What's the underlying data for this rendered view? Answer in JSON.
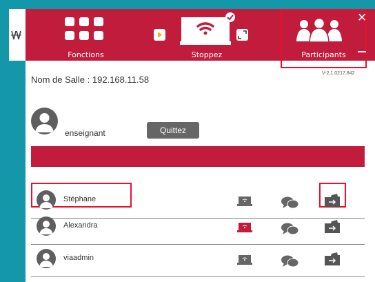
{
  "app": {
    "tabs": {
      "fonctions": "Fonctions",
      "stoppez": "Stoppez",
      "participants": "Participants"
    },
    "close_symbol": "✕"
  },
  "room": {
    "label": "Nom de Salle : 192.168.11.58",
    "version": "V-2.1.0217.842"
  },
  "teacher": {
    "name": "enseignant",
    "quit_label": "Quittez"
  },
  "participants": [
    {
      "name": "Stéphane",
      "screen_active": false
    },
    {
      "name": "Alexandra",
      "screen_active": true
    },
    {
      "name": "viaadmin",
      "screen_active": false
    }
  ],
  "colors": {
    "brand_red": "#c21c3d",
    "background_teal": "#1497a8",
    "icon_gray": "#666666",
    "highlight_red": "#e8102a"
  },
  "icons": [
    "via-logo-icon",
    "grid-icon",
    "wifi-screen-icon",
    "play-icon",
    "expand-icon",
    "group-icon",
    "avatar-icon",
    "screen-icon",
    "chat-icon",
    "transfer-icon"
  ]
}
